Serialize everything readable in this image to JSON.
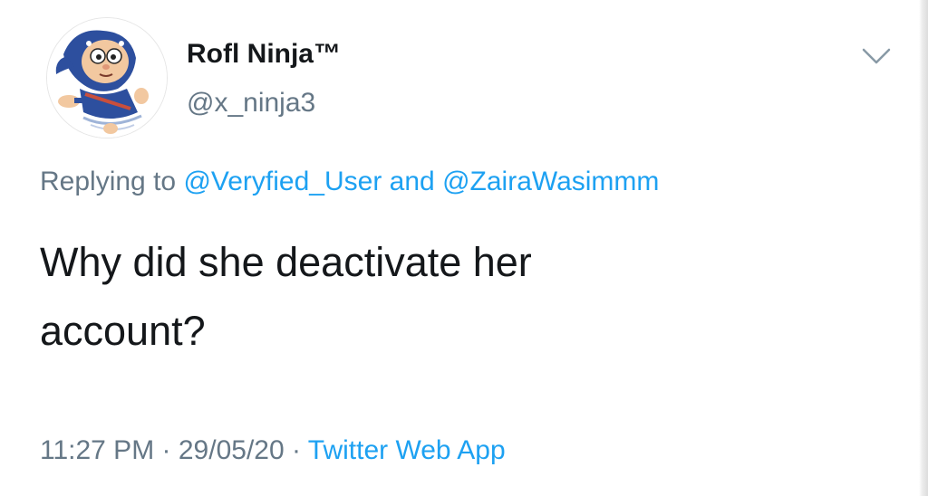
{
  "user": {
    "display_name": "Rofl Ninja™",
    "handle": "@x_ninja3",
    "avatar": "ninja-cartoon-avatar"
  },
  "menu": {
    "icon": "chevron-down-icon"
  },
  "reply": {
    "prefix": "Replying to",
    "mention_1": "@Veryfied_User",
    "conjunction": "and",
    "mention_2": "@ZairaWasimmm"
  },
  "tweet": {
    "text_line_1": "Why did she deactivate her",
    "text_line_2": "account?"
  },
  "meta": {
    "time": "11:27 PM",
    "separator": "·",
    "date": "29/05/20",
    "source": "Twitter Web App"
  },
  "colors": {
    "link": "#1da1f2",
    "secondary_text": "#657786",
    "primary_text": "#14171a"
  }
}
